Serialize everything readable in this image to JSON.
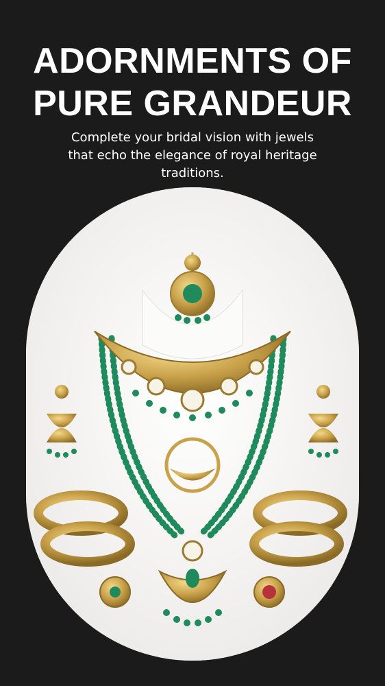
{
  "hero": {
    "title_line1": "ADORNMENTS OF",
    "title_line2": "PURE GRANDEUR",
    "description": "Complete your bridal vision with jewels that echo the elegance of royal heritage traditions."
  },
  "image": {
    "subject": "bridal-jewellery-set-photo",
    "colors": {
      "background": "#1b1b1b",
      "gold": "#c9a14a",
      "emerald": "#1f8a5b",
      "ruby": "#b8323c"
    }
  }
}
